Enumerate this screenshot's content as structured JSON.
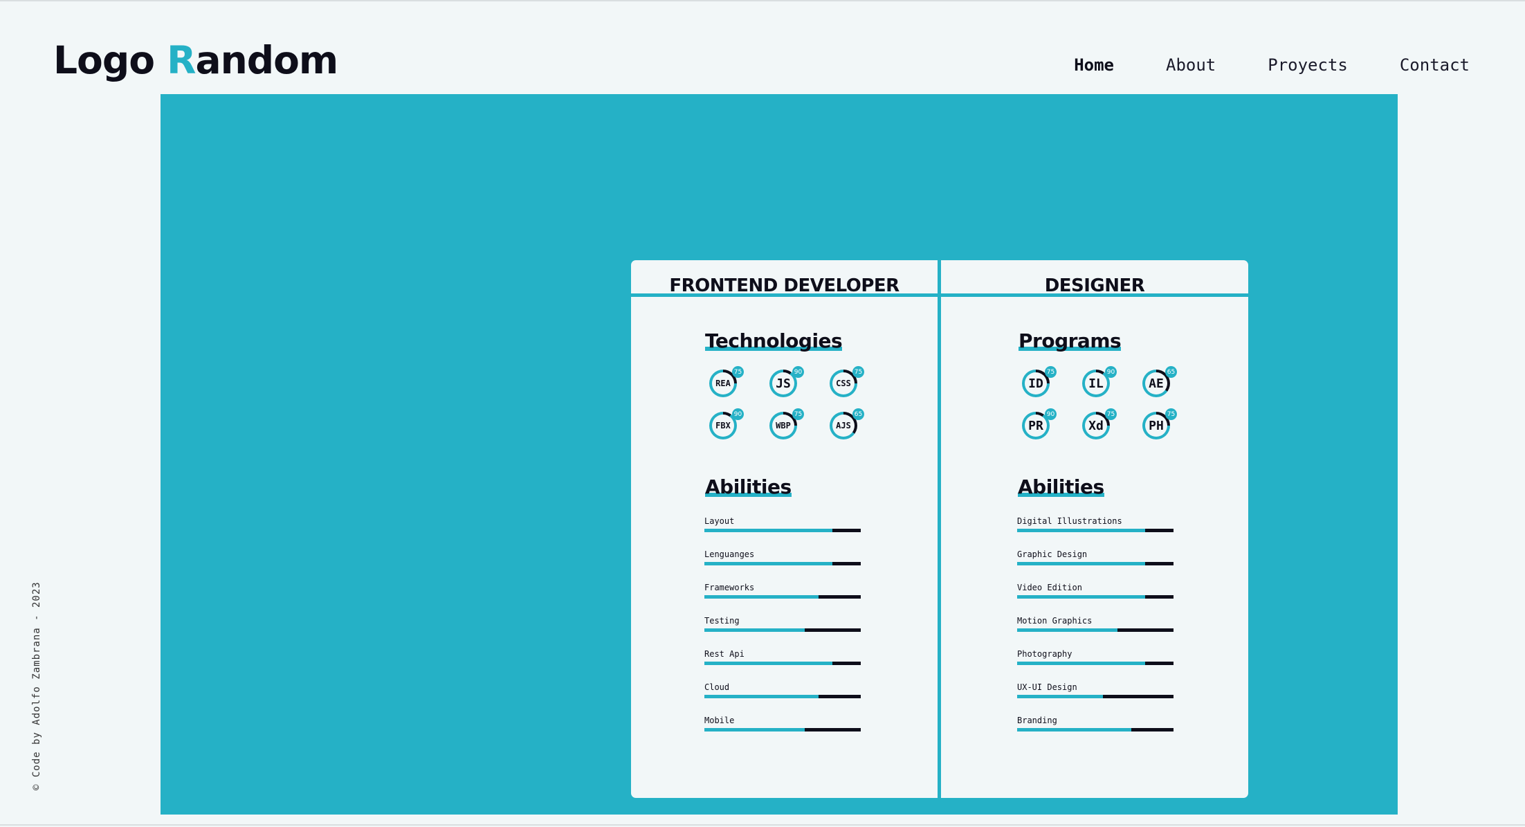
{
  "header": {
    "logo_prefix": "Logo ",
    "logo_accent": "R",
    "logo_suffix": "andom",
    "nav": [
      {
        "label": "Home",
        "active": true
      },
      {
        "label": "About",
        "active": false
      },
      {
        "label": "Proyects",
        "active": false
      },
      {
        "label": "Contact",
        "active": false
      }
    ]
  },
  "credit": "© Code by Adolfo Zambrana - 2023",
  "colors": {
    "accent": "#25b1c6",
    "dark": "#0e0e1a",
    "background": "#f2f7f8"
  },
  "frontend": {
    "title": "FRONTEND DEVELOPER",
    "tech_heading": "Technologies",
    "technologies": [
      {
        "abbr": "REA",
        "pct": 75
      },
      {
        "abbr": "JS",
        "pct": 90
      },
      {
        "abbr": "CSS",
        "pct": 75
      },
      {
        "abbr": "FBX",
        "pct": 90
      },
      {
        "abbr": "WBP",
        "pct": 75
      },
      {
        "abbr": "AJS",
        "pct": 65
      }
    ],
    "abilities_heading": "Abilities",
    "abilities": [
      {
        "label": "Layout",
        "pct": 82
      },
      {
        "label": "Lenguanges",
        "pct": 82
      },
      {
        "label": "Frameworks",
        "pct": 73
      },
      {
        "label": "Testing",
        "pct": 64
      },
      {
        "label": "Rest Api",
        "pct": 82
      },
      {
        "label": "Cloud",
        "pct": 73
      },
      {
        "label": "Mobile",
        "pct": 64
      }
    ]
  },
  "designer": {
    "title": "DESIGNER",
    "tech_heading": "Programs",
    "technologies": [
      {
        "abbr": "ID",
        "pct": 75
      },
      {
        "abbr": "IL",
        "pct": 90
      },
      {
        "abbr": "AE",
        "pct": 65
      },
      {
        "abbr": "PR",
        "pct": 90
      },
      {
        "abbr": "Xd",
        "pct": 75
      },
      {
        "abbr": "PH",
        "pct": 75
      }
    ],
    "abilities_heading": "Abilities",
    "abilities": [
      {
        "label": "Digital Illustrations",
        "pct": 82
      },
      {
        "label": "Graphic Design",
        "pct": 82
      },
      {
        "label": "Video Edition",
        "pct": 82
      },
      {
        "label": "Motion Graphics",
        "pct": 64
      },
      {
        "label": "Photography",
        "pct": 82
      },
      {
        "label": "UX-UI Design",
        "pct": 55
      },
      {
        "label": "Branding",
        "pct": 73
      }
    ]
  }
}
